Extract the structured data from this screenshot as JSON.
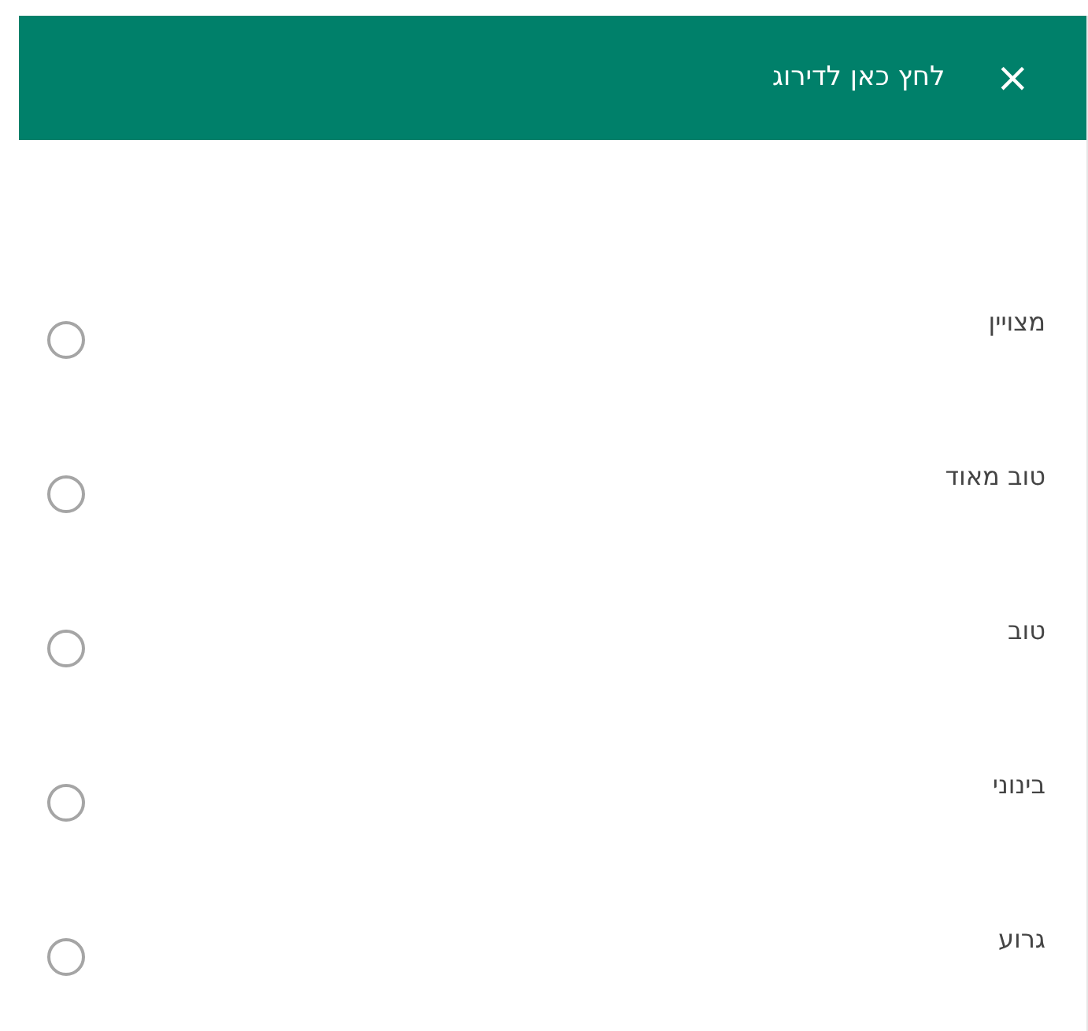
{
  "header": {
    "title": "לחץ כאן לדירוג",
    "close": "×"
  },
  "options": [
    {
      "label": "מצויין",
      "selected": false
    },
    {
      "label": "טוב מאוד",
      "selected": false
    },
    {
      "label": "טוב",
      "selected": false
    },
    {
      "label": "בינוני",
      "selected": false
    },
    {
      "label": "גרוע",
      "selected": false
    }
  ]
}
